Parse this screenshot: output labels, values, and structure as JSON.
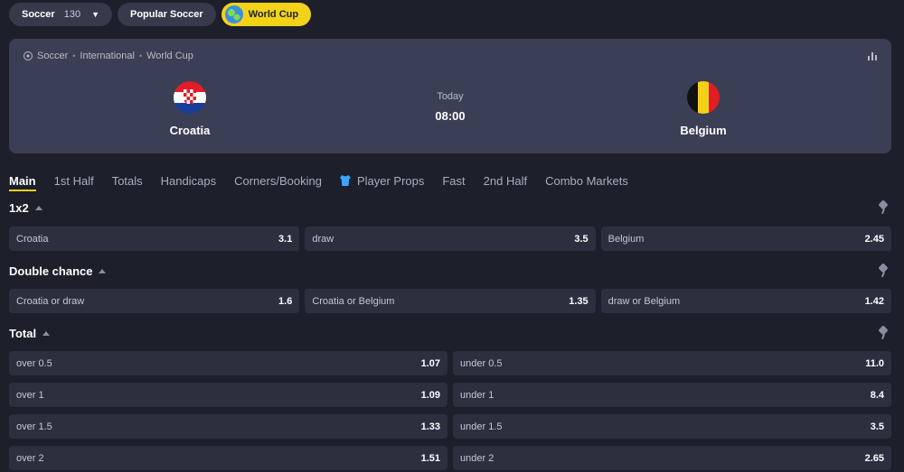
{
  "chips": {
    "soccer": {
      "label": "Soccer",
      "count": "130",
      "caret": "▼"
    },
    "popular": {
      "label": "Popular Soccer"
    },
    "worldcup": {
      "label": "World Cup"
    }
  },
  "event": {
    "breadcrumb": [
      "Soccer",
      "International",
      "World Cup"
    ],
    "home": {
      "name": "Croatia"
    },
    "away": {
      "name": "Belgium"
    },
    "day": "Today",
    "time": "08:00"
  },
  "tabs": [
    "Main",
    "1st Half",
    "Totals",
    "Handicaps",
    "Corners/Booking",
    "Player Props",
    "Fast",
    "2nd Half",
    "Combo Markets"
  ],
  "markets": {
    "m1x2": {
      "title": "1x2",
      "odds": [
        {
          "label": "Croatia",
          "value": "3.1"
        },
        {
          "label": "draw",
          "value": "3.5"
        },
        {
          "label": "Belgium",
          "value": "2.45"
        }
      ]
    },
    "double": {
      "title": "Double chance",
      "odds": [
        {
          "label": "Croatia or draw",
          "value": "1.6"
        },
        {
          "label": "Croatia or Belgium",
          "value": "1.35"
        },
        {
          "label": "draw or Belgium",
          "value": "1.42"
        }
      ]
    },
    "total": {
      "title": "Total",
      "rows": [
        [
          {
            "label": "over 0.5",
            "value": "1.07"
          },
          {
            "label": "under 0.5",
            "value": "11.0"
          }
        ],
        [
          {
            "label": "over 1",
            "value": "1.09"
          },
          {
            "label": "under 1",
            "value": "8.4"
          }
        ],
        [
          {
            "label": "over 1.5",
            "value": "1.33"
          },
          {
            "label": "under 1.5",
            "value": "3.5"
          }
        ],
        [
          {
            "label": "over 2",
            "value": "1.51"
          },
          {
            "label": "under 2",
            "value": "2.65"
          }
        ]
      ]
    }
  },
  "icons": {
    "globe": "globe-icon",
    "ball": "soccer-ball-icon",
    "stats": "stats-icon",
    "pin": "pin-icon",
    "shirt": "shirt-icon",
    "collapse": "collapse-triangle-icon"
  },
  "colors": {
    "background": "#1d1f2b",
    "card": "#3a3f55",
    "accent": "#f3d21a",
    "odd_bg": "#2c2f3e"
  }
}
